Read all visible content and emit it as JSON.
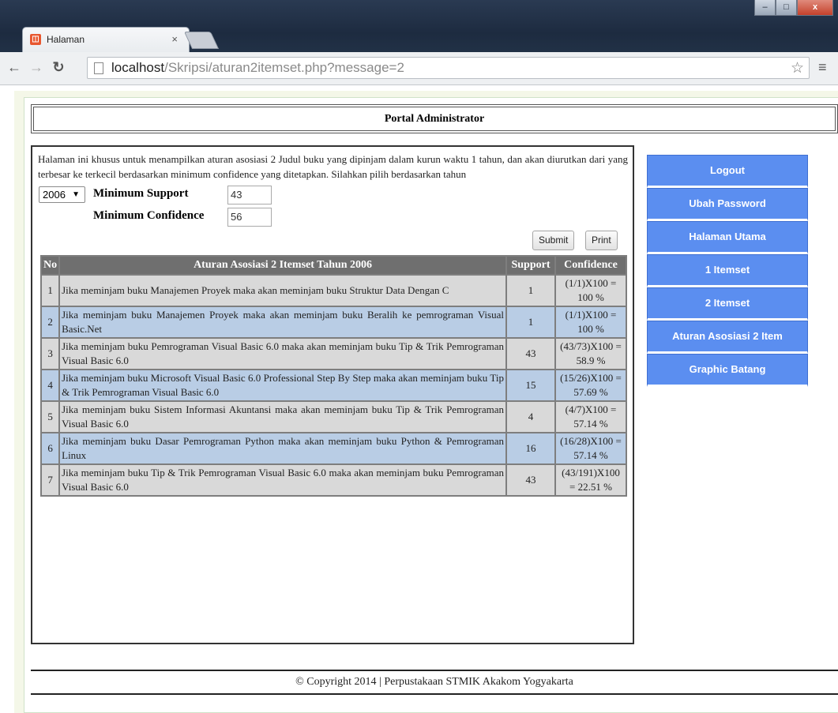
{
  "browser": {
    "tab_title": "Halaman",
    "tab_close": "×",
    "url_host": "localhost",
    "url_path": "/Skripsi/aturan2itemset.php?message=2",
    "window_controls": [
      "–",
      "□",
      "x"
    ]
  },
  "portal": {
    "header": "Portal Administrator"
  },
  "intro_text": "Halaman ini khusus untuk menampilkan aturan asosiasi 2 Judul buku yang dipinjam dalam kurun waktu 1 tahun, dan akan diurutkan dari yang terbesar ke terkecil berdasarkan minimum confidence yang ditetapkan. Silahkan pilih berdasarkan tahun",
  "form": {
    "year": "2006",
    "min_support_label": "Minimum Support",
    "min_support_value": "43",
    "min_conf_label": "Minimum Confidence",
    "min_conf_value": "56",
    "submit_label": "Submit",
    "print_label": "Print"
  },
  "table": {
    "headers": [
      "No",
      "Aturan Asosiasi 2 Itemset Tahun 2006",
      "Support",
      "Confidence"
    ],
    "rows": [
      {
        "no": "1",
        "rule": "Jika meminjam buku Manajemen Proyek maka akan meminjam buku Struktur Data Dengan C",
        "support": "1",
        "confidence": "(1/1)X100 = 100 %"
      },
      {
        "no": "2",
        "rule": "Jika meminjam buku Manajemen Proyek maka akan meminjam buku Beralih ke pemrograman Visual Basic.Net",
        "support": "1",
        "confidence": "(1/1)X100 = 100 %"
      },
      {
        "no": "3",
        "rule": "Jika meminjam buku Pemrograman Visual Basic 6.0 maka akan meminjam buku Tip & Trik Pemrograman Visual Basic 6.0",
        "support": "43",
        "confidence": "(43/73)X100 = 58.9 %"
      },
      {
        "no": "4",
        "rule": "Jika meminjam buku Microsoft Visual Basic 6.0 Professional Step By Step maka akan meminjam buku Tip & Trik Pemrograman Visual Basic 6.0",
        "support": "15",
        "confidence": "(15/26)X100 = 57.69 %"
      },
      {
        "no": "5",
        "rule": "Jika meminjam buku Sistem Informasi Akuntansi maka akan meminjam buku Tip & Trik Pemrograman Visual Basic 6.0",
        "support": "4",
        "confidence": "(4/7)X100 = 57.14 %"
      },
      {
        "no": "6",
        "rule": "Jika meminjam buku Dasar Pemrograman Python maka akan meminjam buku Python & Pemrograman Linux",
        "support": "16",
        "confidence": "(16/28)X100 = 57.14 %"
      },
      {
        "no": "7",
        "rule": "Jika meminjam buku Tip & Trik Pemrograman Visual Basic 6.0 maka akan meminjam buku Pemrograman Visual Basic 6.0",
        "support": "43",
        "confidence": "(43/191)X100 = 22.51 %"
      }
    ]
  },
  "menu": {
    "items": [
      "Logout",
      "Ubah Password",
      "Halaman Utama",
      "1 Itemset",
      "2 Itemset",
      "Aturan Asosiasi 2 Item",
      "Graphic Batang"
    ]
  },
  "footer": "© Copyright 2014 | Perpustakaan STMIK Akakom Yogyakarta",
  "colors": {
    "menu_blue": "#5b8ef0",
    "row_odd": "#d9d9d9",
    "row_even": "#b9cde5",
    "table_header": "#6f6f6f"
  }
}
